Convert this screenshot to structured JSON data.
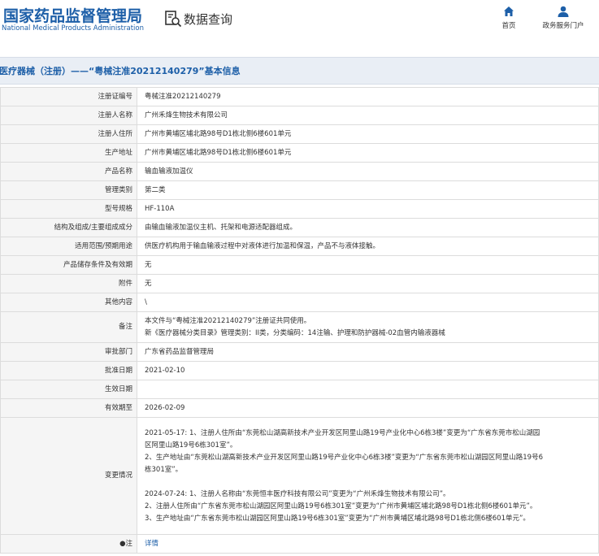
{
  "header": {
    "logo_cn": "国家药品监督管理局",
    "logo_en": "National Medical Products Administration",
    "search_title": "数据查询",
    "nav": [
      {
        "label": "首页",
        "icon": "home-icon"
      },
      {
        "label": "政务服务门户",
        "icon": "user-icon"
      }
    ]
  },
  "page_title": "医疗器械（注册）——“粤械注准20212140279”基本信息",
  "rows": [
    {
      "label": "注册证编号",
      "lines": [
        "粤械注准20212140279"
      ]
    },
    {
      "label": "注册人名称",
      "lines": [
        "广州禾烽生物技术有限公司"
      ]
    },
    {
      "label": "注册人住所",
      "lines": [
        "广州市黄埔区埔北路98号D1栋北侧6楼601单元"
      ]
    },
    {
      "label": "生产地址",
      "lines": [
        "广州市黄埔区埔北路98号D1栋北侧6楼601单元"
      ]
    },
    {
      "label": "产品名称",
      "lines": [
        "输血输液加温仪"
      ]
    },
    {
      "label": "管理类别",
      "lines": [
        "第二类"
      ]
    },
    {
      "label": "型号规格",
      "lines": [
        "HF-110A"
      ]
    },
    {
      "label": "结构及组成/主要组成成分",
      "lines": [
        "由输血输液加温仪主机、托架和电源适配器组成。"
      ]
    },
    {
      "label": "适用范围/预期用途",
      "lines": [
        "供医疗机构用于输血输液过程中对液体进行加温和保温，产品不与液体接触。"
      ]
    },
    {
      "label": "产品储存条件及有效期",
      "lines": [
        "无"
      ]
    },
    {
      "label": "附件",
      "lines": [
        "无"
      ]
    },
    {
      "label": "其他内容",
      "lines": [
        "\\"
      ]
    },
    {
      "label": "备注",
      "lines": [
        "本文件与“粤械注准20212140279”注册证共同使用。",
        "新《医疗器械分类目录》管理类别：II类，分类编码：14注输、护理和防护器械-02血管内输液器械"
      ]
    },
    {
      "label": "审批部门",
      "lines": [
        "广东省药品监督管理局"
      ]
    },
    {
      "label": "批准日期",
      "lines": [
        "2021-02-10"
      ]
    },
    {
      "label": "生效日期",
      "lines": [
        ""
      ]
    },
    {
      "label": "有效期至",
      "lines": [
        "2026-02-09"
      ]
    },
    {
      "label": "变更情况",
      "lines": [
        "2021-05-17: 1、注册人住所由“东莞松山湖高新技术产业开发区阿里山路19号产业化中心6栋3楼”变更为“广东省东莞市松山湖园",
        "区阿里山路19号6栋301室”。",
        "2、生产地址由“东莞松山湖高新技术产业开发区阿里山路19号产业化中心6栋3楼”变更为“广东省东莞市松山湖园区阿里山路19号6",
        "栋301室”。",
        "",
        "2024-07-24: 1、注册人名称由“东莞恒丰医疗科技有限公司”变更为“广州禾烽生物技术有限公司”。",
        "2、注册人住所由“广东省东莞市松山湖园区阿里山路19号6栋301室”变更为“广州市黄埔区埔北路98号D1栋北侧6楼601单元”。",
        "3、生产地址由“广东省东莞市松山湖园区阿里山路19号6栋301室”变更为“广州市黄埔区埔北路98号D1栋北侧6楼601单元”。"
      ]
    }
  ],
  "note_row": {
    "label": "●注",
    "link": "详情"
  }
}
